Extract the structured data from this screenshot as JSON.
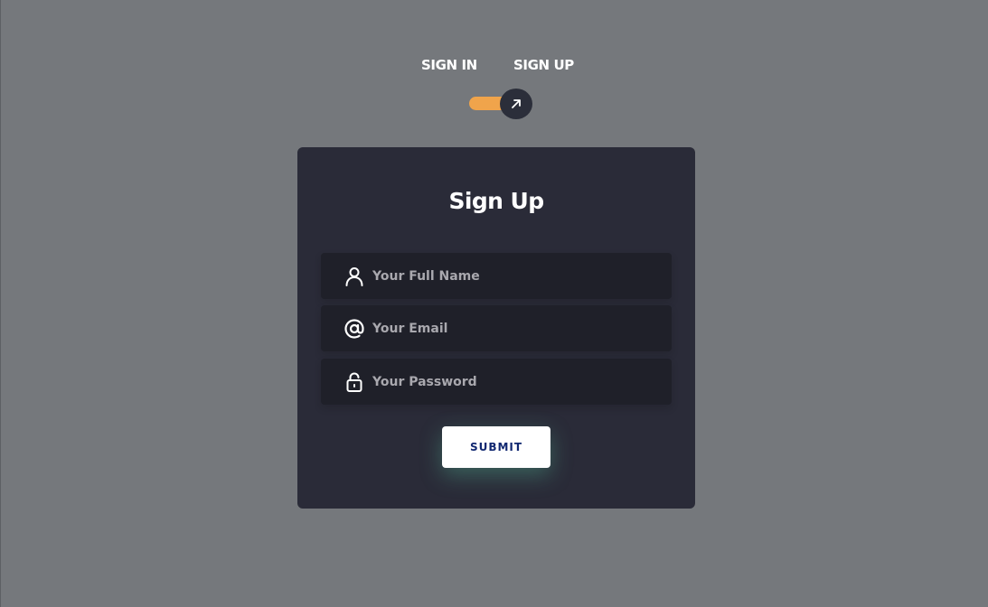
{
  "tabs": {
    "sign_in": "SIGN IN",
    "sign_up": "SIGN UP"
  },
  "toggle": {
    "state": "sign-up",
    "track_color": "#f0a44b",
    "knob_color": "#2b2e3a",
    "icon": "arrow-up-right-icon"
  },
  "form": {
    "title": "Sign Up",
    "fields": [
      {
        "icon": "user-icon",
        "placeholder": "Your Full Name",
        "value": ""
      },
      {
        "icon": "at-sign-icon",
        "placeholder": "Your Email",
        "value": ""
      },
      {
        "icon": "lock-icon",
        "placeholder": "Your Password",
        "value": ""
      }
    ],
    "submit_label": "SUBMIT"
  },
  "colors": {
    "background": "#75787c",
    "card": "#2a2b38",
    "field": "#1f2029",
    "accent": "#f0a44b",
    "button_text": "#102770"
  }
}
